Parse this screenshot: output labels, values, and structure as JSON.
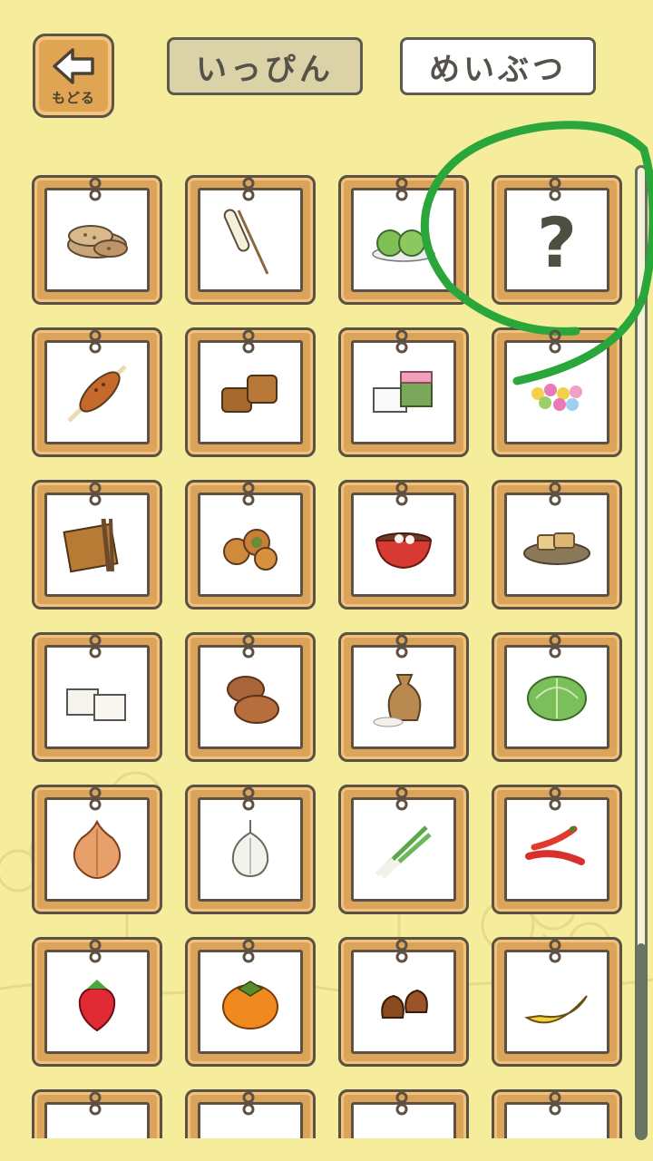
{
  "header": {
    "back_label": "もどる",
    "tabs": [
      {
        "label": "いっぴん",
        "selected": true
      },
      {
        "label": "めいぶつ",
        "selected": false
      }
    ]
  },
  "colors": {
    "background": "#f5ed9c",
    "frame": "#dca35a",
    "outline": "#5c5142",
    "annotation": "#2aa63a"
  },
  "locked_item": {
    "symbol": "?"
  },
  "items": [
    {
      "name": "senbei-icon",
      "locked": false
    },
    {
      "name": "skewer-icon",
      "locked": false
    },
    {
      "name": "green-mochi-icon",
      "locked": false
    },
    {
      "name": "unknown-item-icon",
      "locked": true
    },
    {
      "name": "grilled-dango-icon",
      "locked": false
    },
    {
      "name": "brown-cubes-icon",
      "locked": false
    },
    {
      "name": "layered-cake-icon",
      "locked": false
    },
    {
      "name": "colorful-candy-icon",
      "locked": false
    },
    {
      "name": "dried-food-bundle-icon",
      "locked": false
    },
    {
      "name": "round-buns-icon",
      "locked": false
    },
    {
      "name": "red-soup-bowl-icon",
      "locked": false
    },
    {
      "name": "fried-tofu-plate-icon",
      "locked": false
    },
    {
      "name": "tofu-blocks-icon",
      "locked": false
    },
    {
      "name": "manju-icon",
      "locked": false
    },
    {
      "name": "rice-sack-icon",
      "locked": false
    },
    {
      "name": "cabbage-icon",
      "locked": false
    },
    {
      "name": "onion-icon",
      "locked": false
    },
    {
      "name": "garlic-icon",
      "locked": false
    },
    {
      "name": "green-onion-icon",
      "locked": false
    },
    {
      "name": "chili-pepper-icon",
      "locked": false
    },
    {
      "name": "strawberry-icon",
      "locked": false
    },
    {
      "name": "persimmon-icon",
      "locked": false
    },
    {
      "name": "chestnut-icon",
      "locked": false
    },
    {
      "name": "banana-icon",
      "locked": false
    },
    {
      "name": "partial-item-icon",
      "locked": false
    },
    {
      "name": "partial-item-icon",
      "locked": false
    },
    {
      "name": "partial-item-icon",
      "locked": false
    },
    {
      "name": "partial-item-icon",
      "locked": false
    }
  ],
  "annotation": {
    "shape": "circle",
    "color": "#2aa63a",
    "target": "unknown-item-icon"
  }
}
